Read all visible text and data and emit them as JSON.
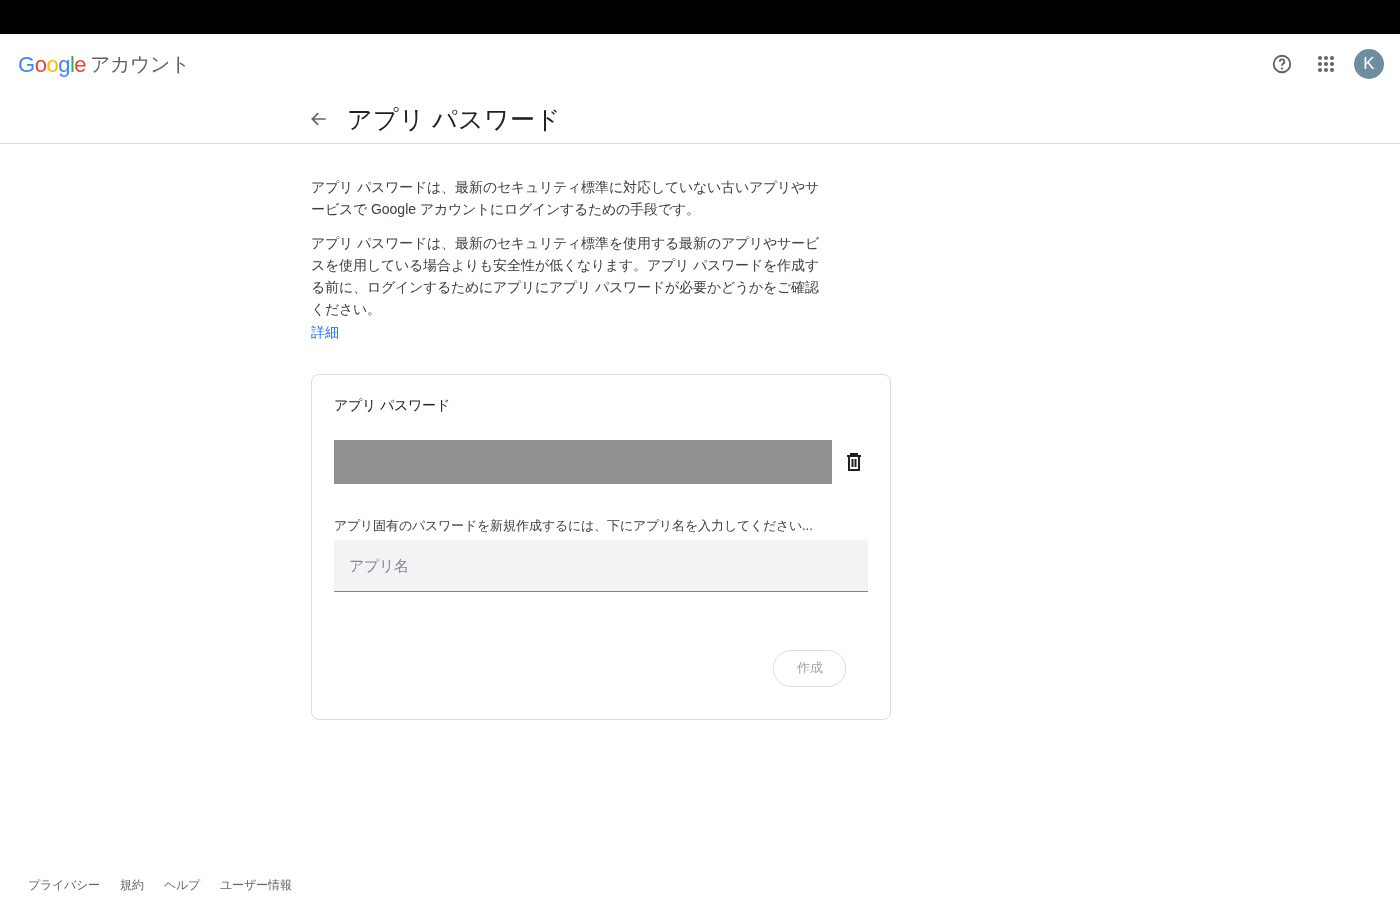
{
  "header": {
    "logo": "Google",
    "product": "アカウント",
    "avatar_initial": "K"
  },
  "page": {
    "title": "アプリ パスワード"
  },
  "intro": [
    "アプリ パスワードは、最新のセキュリティ標準に対応していない古いアプリやサービスで Google アカウントにログインするための手段です。",
    "アプリ パスワードは、最新のセキュリティ標準を使用する最新のアプリやサービスを使用している場合よりも安全性が低くなります。アプリ パスワードを作成する前に、ログインするためにアプリにアプリ パスワードが必要かどうかをご確認ください。"
  ],
  "learn_more": "詳細",
  "card": {
    "title": "アプリ パスワード",
    "instruction": "アプリ固有のパスワードを新規作成するには、下にアプリ名を入力してください...",
    "field": {
      "placeholder": "アプリ名"
    },
    "button": {
      "label": "作成",
      "disabled": true
    }
  },
  "footer": [
    "プライバシー",
    "規約",
    "ヘルプ",
    "ユーザー情報"
  ]
}
